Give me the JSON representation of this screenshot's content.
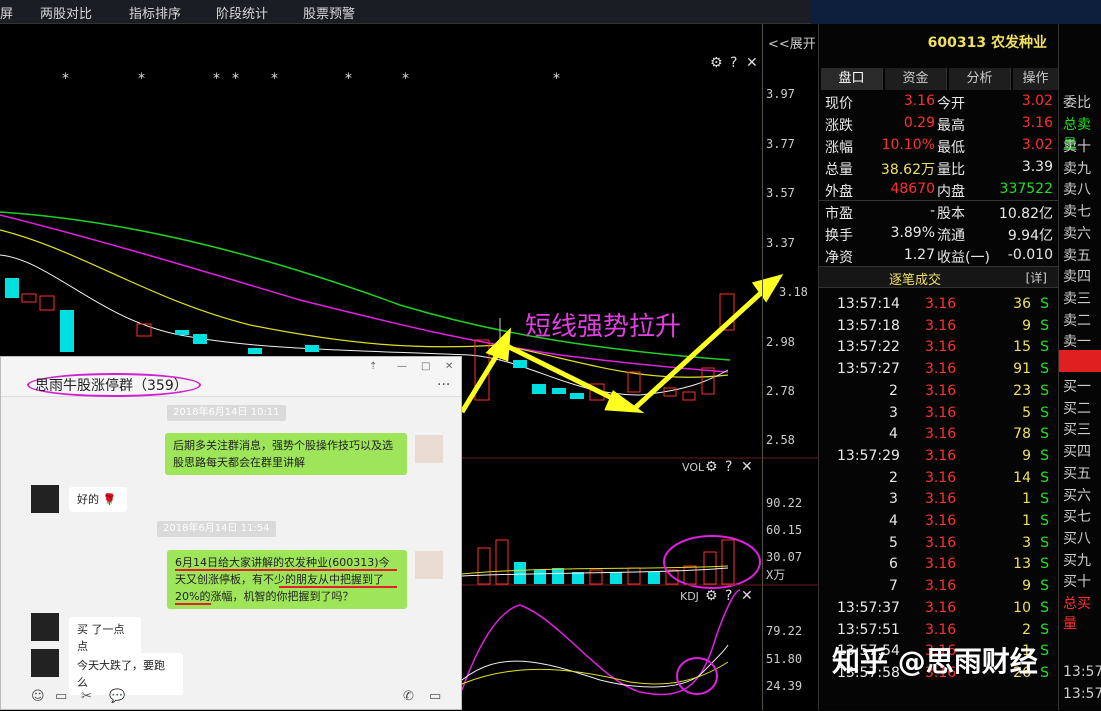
{
  "topnav": {
    "items": [
      "屏",
      "两股对比",
      "指标排序",
      "阶段统计",
      "股票预警"
    ]
  },
  "chart": {
    "expand_label": "<<展开",
    "price_ticks": [
      "3.97",
      "3.77",
      "3.57",
      "3.37",
      "3.18",
      "2.98",
      "2.78",
      "2.58"
    ],
    "vol_title": "VOL",
    "vol_ticks": [
      "90.22",
      "60.15",
      "30.07",
      "X万"
    ],
    "kdj_title": "KDJ",
    "kdj_ticks": [
      "79.22",
      "51.80",
      "24.39"
    ],
    "annotation": "短线强势拉升",
    "controls": {
      "gear": "⚙",
      "help": "?",
      "close": "✕"
    },
    "star": "*"
  },
  "quote": {
    "code_name": "600313 农发种业",
    "tabs": [
      "盘口",
      "资金",
      "分析",
      "操作"
    ],
    "rows": [
      {
        "l1": "现价",
        "v1": "3.16",
        "l2": "今开",
        "v2": "3.02"
      },
      {
        "l1": "涨跌",
        "v1": "0.29",
        "l2": "最高",
        "v2": "3.16"
      },
      {
        "l1": "涨幅",
        "v1": "10.10%",
        "l2": "最低",
        "v2": "3.02"
      },
      {
        "l1": "总量",
        "v1": "38.62万",
        "l2": "量比",
        "v2": "3.39"
      },
      {
        "l1": "外盘",
        "v1": "48670",
        "l2": "内盘",
        "v2": "337522"
      },
      {
        "l1": "市盈",
        "v1": "-",
        "l2": "股本",
        "v2": "10.82亿"
      },
      {
        "l1": "换手",
        "v1": "3.89%",
        "l2": "流通",
        "v2": "9.94亿"
      },
      {
        "l1": "净资",
        "v1": "1.27",
        "l2": "收益(一)",
        "v2": "-0.010"
      }
    ],
    "tick_header": "逐笔成交",
    "tick_detail": "[详]",
    "ticks": [
      {
        "t": "13:57:14",
        "p": "3.16",
        "v": "36",
        "s": "S"
      },
      {
        "t": "13:57:18",
        "p": "3.16",
        "v": "9",
        "s": "S"
      },
      {
        "t": "13:57:22",
        "p": "3.16",
        "v": "15",
        "s": "S"
      },
      {
        "t": "13:57:27",
        "p": "3.16",
        "v": "91",
        "s": "S"
      },
      {
        "t": "2",
        "p": "3.16",
        "v": "23",
        "s": "S"
      },
      {
        "t": "3",
        "p": "3.16",
        "v": "5",
        "s": "S"
      },
      {
        "t": "4",
        "p": "3.16",
        "v": "78",
        "s": "S"
      },
      {
        "t": "13:57:29",
        "p": "3.16",
        "v": "9",
        "s": "S"
      },
      {
        "t": "2",
        "p": "3.16",
        "v": "14",
        "s": "S"
      },
      {
        "t": "3",
        "p": "3.16",
        "v": "1",
        "s": "S"
      },
      {
        "t": "4",
        "p": "3.16",
        "v": "1",
        "s": "S"
      },
      {
        "t": "5",
        "p": "3.16",
        "v": "3",
        "s": "S"
      },
      {
        "t": "6",
        "p": "3.16",
        "v": "13",
        "s": "S"
      },
      {
        "t": "7",
        "p": "3.16",
        "v": "9",
        "s": "S"
      },
      {
        "t": "13:57:37",
        "p": "3.16",
        "v": "10",
        "s": "S"
      },
      {
        "t": "13:57:51",
        "p": "3.16",
        "v": "2",
        "s": "S"
      },
      {
        "t": "13:57:54",
        "p": "3.16",
        "v": "1",
        "s": "S"
      },
      {
        "t": "13:57:58",
        "p": "3.16",
        "v": "26",
        "s": "S"
      }
    ]
  },
  "orderbook": {
    "top": [
      "委比",
      "总卖量"
    ],
    "sells": [
      "卖十",
      "卖九",
      "卖八",
      "卖七",
      "卖六",
      "卖五",
      "卖四",
      "卖三",
      "卖二",
      "卖一"
    ],
    "buys": [
      "买一",
      "买二",
      "买三",
      "买四",
      "买五",
      "买六",
      "买七",
      "买八",
      "买九",
      "买十"
    ],
    "bottom": [
      "总买量",
      "13:57",
      "13:57"
    ]
  },
  "chat": {
    "title": "思雨牛股涨停群（359）",
    "window_buttons": [
      "⇡",
      "—",
      "□",
      "✕"
    ],
    "more": "···",
    "messages": [
      {
        "type": "time",
        "text": "2018年6月14日 10:11"
      },
      {
        "type": "me",
        "text": "后期多关注群消息，强势个股操作技巧以及选股思路每天都会在群里讲解"
      },
      {
        "type": "other",
        "text": "好的 🌹"
      },
      {
        "type": "time",
        "text": "2018年6月14日 11:54"
      },
      {
        "type": "me",
        "text": "6月14日给大家讲解的农发种业(600313)今天又创涨停板，有不少的朋友从中把握到了20%的涨幅，机智的你把握到了吗？"
      },
      {
        "type": "other",
        "text": "买 了一点点"
      },
      {
        "type": "other",
        "text": "今天大跌了，要跑么"
      }
    ],
    "toolbar_icons": [
      "☺",
      "▭",
      "✂",
      "💬",
      "✆",
      "▭"
    ]
  },
  "watermark": "知乎 @思雨财经",
  "colors": {
    "red": "#ff3030",
    "green": "#20e020",
    "cyan": "#00e0e0",
    "magenta": "#e040e0",
    "yellow": "#f0f020",
    "annot_arrow": "#ffff20"
  }
}
